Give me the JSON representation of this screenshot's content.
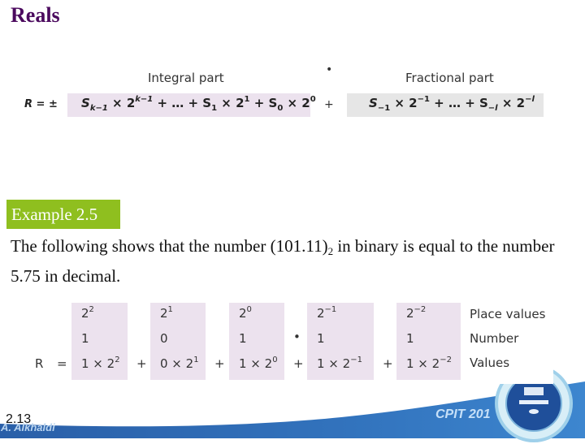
{
  "slide": {
    "title": "Reals",
    "formula": {
      "integral_label": "Integral part",
      "fractional_label": "Fractional part",
      "radix_point": "•",
      "lhs": "R = ±",
      "plus": "+",
      "integral_expr": {
        "t1": "S",
        "t1_sub": "k−1",
        "t1_mid": " × 2",
        "t1_sup": "k−1",
        "t2": " + … + S",
        "t2_sub": "1",
        "t2_mid": " × 2",
        "t2_sup": "1",
        "t3": " + S",
        "t3_sub": "0",
        "t3_mid": " × 2",
        "t3_sup": "0"
      },
      "fractional_expr": {
        "t1": "S",
        "t1_sub": "−1",
        "t1_mid": " × 2",
        "t1_sup": "−1",
        "t2": " + …  +  S",
        "t2_sub": "−l",
        "t2_mid": " × 2",
        "t2_sup": "−l"
      }
    },
    "example": {
      "badge": "Example 2.5",
      "text_pre": "The following shows that the number (101.11)",
      "text_sub": "2",
      "text_post": " in binary is equal to the number 5.75 in decimal."
    },
    "table": {
      "lhs": "R",
      "equals": "=",
      "radix_point": "•",
      "plus": "+",
      "columns": [
        {
          "place_base": "2",
          "place_exp": "2",
          "digit": "1",
          "value_pre": "1 × 2",
          "value_exp": "2"
        },
        {
          "place_base": "2",
          "place_exp": "1",
          "digit": "0",
          "value_pre": "0 × 2",
          "value_exp": "1"
        },
        {
          "place_base": "2",
          "place_exp": "0",
          "digit": "1",
          "value_pre": "1 × 2",
          "value_exp": "0"
        },
        {
          "place_base": "2",
          "place_exp": "−1",
          "digit": "1",
          "value_pre": "1 × 2",
          "value_exp": "−1"
        },
        {
          "place_base": "2",
          "place_exp": "−2",
          "digit": "1",
          "value_pre": "1 × 2",
          "value_exp": "−2"
        }
      ],
      "row_labels": [
        "Place values",
        "Number",
        "Values"
      ]
    },
    "footer": {
      "page_number": "2.13",
      "author": "A. Alkhaldi",
      "course": "CPIT 201",
      "logo_icon": "university-seal-icon"
    },
    "colors": {
      "title": "#4b0a5e",
      "badge": "#8fbf1f",
      "integral_bg": "#ece2ee",
      "fractional_bg": "#e6e6e6",
      "footer_blue": "#2f6cb5"
    }
  }
}
